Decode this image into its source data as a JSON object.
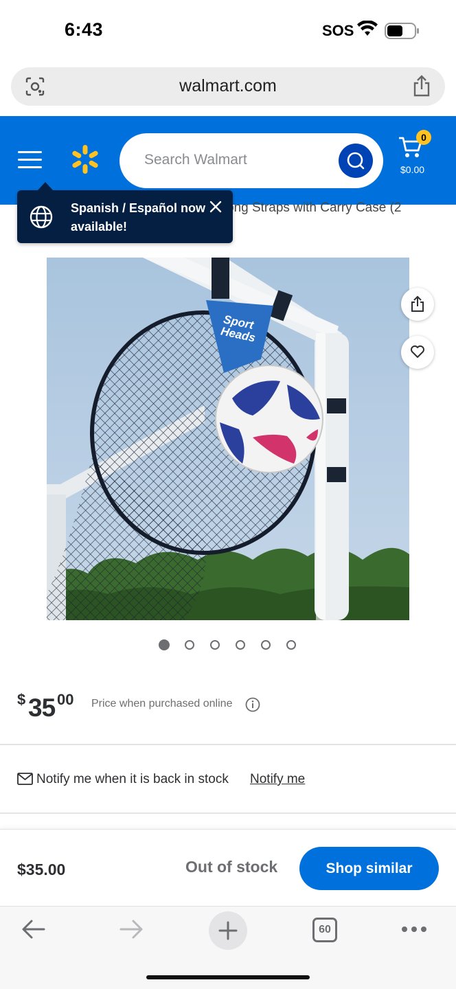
{
  "status_bar": {
    "time": "6:43",
    "carrier": "SOS"
  },
  "browser": {
    "url": "walmart.com",
    "tab_count": "60"
  },
  "header": {
    "search_placeholder": "Search Walmart",
    "cart_count": "0",
    "cart_total": "$0.00",
    "brand_color": "#0071dc"
  },
  "tooltip": {
    "text": "Spanish / Español now available!"
  },
  "product": {
    "title_fragment": "ong Straps with Carry Case (2",
    "image_text": [
      "Sport",
      "Heads"
    ],
    "carousel": {
      "count": 6,
      "active": 0
    },
    "price": {
      "currency": "$",
      "whole": "35",
      "cents": "00",
      "note": "Price when purchased online"
    }
  },
  "stock": {
    "notify_text": "Notify me when it is back in stock",
    "notify_link": "Notify me"
  },
  "sticky": {
    "price": "$35.00",
    "status": "Out of stock",
    "button": "Shop similar"
  },
  "icons": {
    "status": [
      "wifi-icon",
      "battery-icon"
    ],
    "url_bar": [
      "camera-search-icon",
      "share-icon"
    ],
    "header": [
      "menu-icon",
      "walmart-spark-icon",
      "search-icon",
      "cart-icon"
    ],
    "toolbar": [
      "back-arrow-icon",
      "forward-arrow-icon",
      "plus-icon",
      "tabs-icon",
      "more-icon"
    ]
  }
}
